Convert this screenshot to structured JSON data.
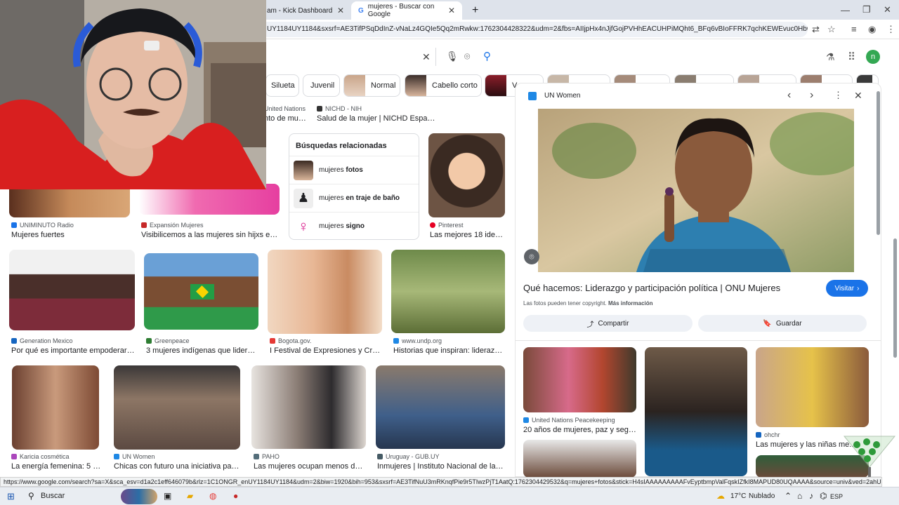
{
  "browser": {
    "tabs": [
      {
        "label": "am - Kick Dashboard",
        "active": false
      },
      {
        "label": "mujeres - Buscar con Google",
        "active": true
      }
    ],
    "new_tab": "+",
    "url": "UY1184UY1184&sxsrf=AE3TifPSqDdInZ-vNaLz4GQIe5Qq2mRwkw:1762304428322&udm=2&fbs=AIIjpHx4nJjfGojPVHhEACUHPiMQht6_BFq6vBIoFFRK7qchKEWEvuc0Hbw31oEI7c8o3y4..."
  },
  "search": {
    "clear_icon": "✕",
    "profile_initial": "n"
  },
  "chips": [
    {
      "label": "Silueta"
    },
    {
      "label": "Juvenil"
    },
    {
      "label": "Normal"
    },
    {
      "label": "Cabello corto"
    },
    {
      "label": "V"
    }
  ],
  "row0": [
    {
      "source": "United Nations",
      "title": "nto de muj..."
    },
    {
      "source": "NICHD - NIH",
      "title": "Salud de la mujer | NICHD Español"
    }
  ],
  "related": {
    "header": "Búsquedas relacionadas",
    "items": [
      {
        "prefix": "mujeres ",
        "bold": "fotos"
      },
      {
        "prefix": "mujeres ",
        "bold": "en traje de baño"
      },
      {
        "prefix": "mujeres ",
        "bold": "signo"
      }
    ]
  },
  "row1": [
    {
      "source": "UNIMINUTO Radio",
      "title": "Mujeres fuertes",
      "color": "#1a73e8"
    },
    {
      "source": "Expansión Mujeres",
      "title": "Visibilicemos a las mujeres sin hijxs en el ...",
      "color": "#c62828"
    },
    {
      "source": "Pinterest",
      "title": "Las mejores 18 ideas ...",
      "color": "#e60023"
    }
  ],
  "row2": [
    {
      "source": "Generation Mexico",
      "title": "Por qué es importante empoderar a la...",
      "color": "#1565c0"
    },
    {
      "source": "Greenpeace",
      "title": "3 mujeres indígenas que lideran l...",
      "color": "#2e7d32"
    },
    {
      "source": "Bogota.gov.",
      "title": "I Festival de Expresiones y Creaci...",
      "color": "#e53935"
    },
    {
      "source": "www.undp.org",
      "title": "Historias que inspiran: liderazgos ...",
      "color": "#1e88e5"
    }
  ],
  "row3": [
    {
      "source": "Karicia cosmética",
      "title": "La energía femenina: 5 muj...",
      "color": "#ab47bc"
    },
    {
      "source": "UN Women",
      "title": "Chicas con futuro una iniciativa para el ...",
      "color": "#1e88e5"
    },
    {
      "source": "PAHO",
      "title": "Las mujeres ocupan menos del 30...",
      "color": "#546e7a"
    },
    {
      "source": "Uruguay - GUB.UY",
      "title": "Inmujeres | Instituto Nacional de las Mu...",
      "color": "#455a64"
    }
  ],
  "panel": {
    "source": "UN Women",
    "title": "Qué hacemos: Liderazgo y participación política | ONU Mujeres",
    "visit": "Visitar",
    "copyright": "Las fotos pueden tener copyright.",
    "more_info": "Más información",
    "share": "Compartir",
    "save": "Guardar",
    "related": [
      {
        "source": "United Nations Peacekeeping",
        "title": "20 años de mujeres, paz y segurid..."
      },
      {
        "source": "ohchr",
        "title": "Las mujeres y las niñas me..."
      }
    ]
  },
  "status_url": "https://www.google.com/search?sa=X&sca_esv=d1a2c1eff646079b&rlz=1C1ONGR_enUY1184UY1184&udm=2&biw=1920&bih=953&sxsrf=AE3TifNuU3mRKnqfPie9r5TIwzPjT1AatQ:1762304429532&q=mujeres+fotos&stick=H4sIAAAAAAAAAFvEyptbmpValFqskIZfkI8MAPUD80UQAAAA&source=univ&ved=2ahUKEwiPm4jM59mQAxUjLkGHQrdA...",
  "taskbar": {
    "search": "Buscar",
    "weather_temp": "17°C",
    "weather_desc": "Nublado",
    "lang": "ESP"
  }
}
